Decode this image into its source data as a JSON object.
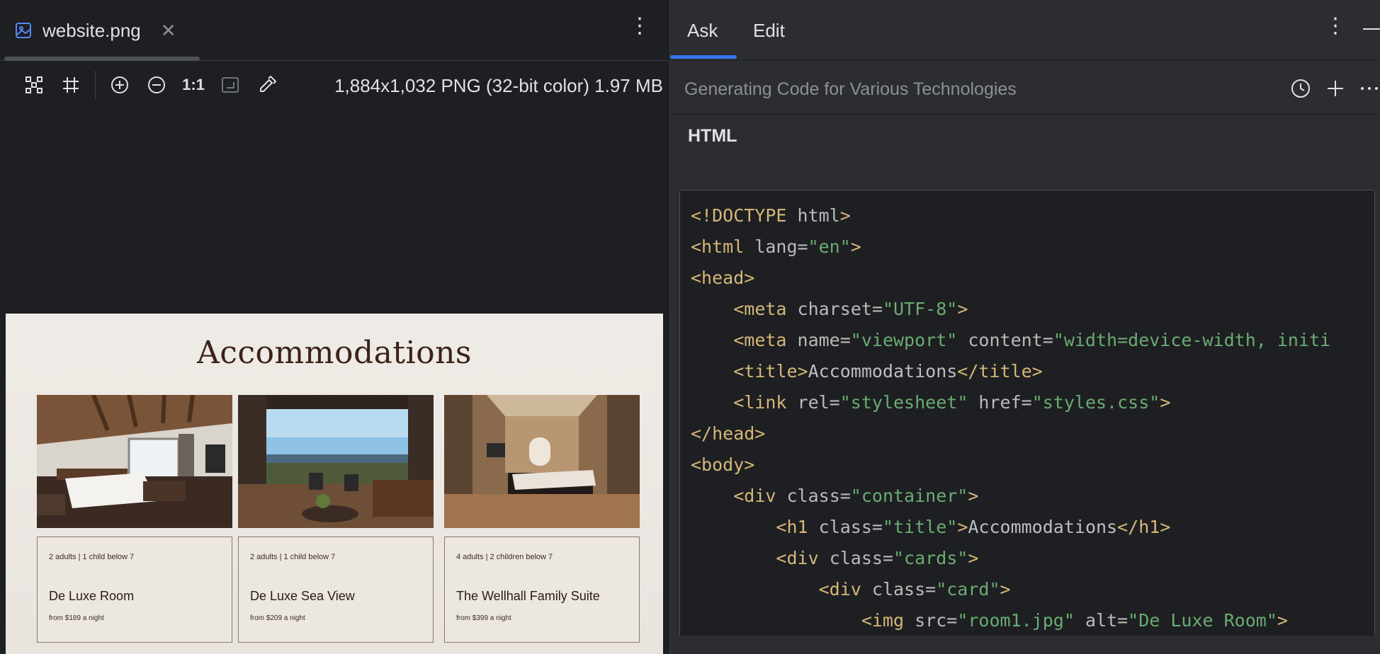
{
  "viewer": {
    "tab": {
      "label": "website.png",
      "icon": "image-file-icon",
      "close": "✕"
    },
    "menu_glyph": "⋮",
    "toolbar": {
      "tools": [
        "fit-to-window-icon",
        "grid-icon",
        "zoom-in-icon",
        "zoom-out-icon"
      ],
      "actual_size_label": "1:1",
      "extra_tools": [
        "background-toggle-icon",
        "color-picker-icon"
      ]
    },
    "image_info": "1,884x1,032 PNG (32-bit color) 1.97 MB",
    "preview": {
      "title": "Accommodations",
      "cards": [
        {
          "guests": "2 adults | 1 child below 7",
          "name": "De Luxe Room",
          "price": "from $189 a night"
        },
        {
          "guests": "2 adults | 1 child below 7",
          "name": "De Luxe Sea View",
          "price": "from $209 a night"
        },
        {
          "guests": "4 adults | 2 children below 7",
          "name": "The Wellhall Family Suite",
          "price": "from $399 a night"
        }
      ]
    }
  },
  "assistant": {
    "tabs": [
      {
        "label": "Ask",
        "active": true
      },
      {
        "label": "Edit",
        "active": false
      }
    ],
    "menu_glyph": "⋮",
    "chat_title": "Generating Code for Various Technologies",
    "chat_actions": [
      "history-icon",
      "new-chat-icon",
      "more-icon"
    ],
    "section_label": "HTML",
    "code_lines": [
      [
        [
          "t",
          "<!DOCTYPE"
        ],
        [
          "a",
          " html"
        ],
        [
          "t",
          ">"
        ]
      ],
      [
        [
          "t",
          "<html "
        ],
        [
          "a",
          "lang="
        ],
        [
          "v",
          "\"en\""
        ],
        [
          "t",
          ">"
        ]
      ],
      [
        [
          "t",
          "<head>"
        ]
      ],
      [
        [
          "x",
          "    "
        ],
        [
          "t",
          "<meta "
        ],
        [
          "a",
          "charset="
        ],
        [
          "v",
          "\"UTF-8\""
        ],
        [
          "t",
          ">"
        ]
      ],
      [
        [
          "x",
          "    "
        ],
        [
          "t",
          "<meta "
        ],
        [
          "a",
          "name="
        ],
        [
          "v",
          "\"viewport\""
        ],
        [
          "a",
          " content="
        ],
        [
          "v",
          "\"width=device-width, initi"
        ]
      ],
      [
        [
          "x",
          "    "
        ],
        [
          "t",
          "<title>"
        ],
        [
          "x",
          "Accommodations"
        ],
        [
          "t",
          "</title>"
        ]
      ],
      [
        [
          "x",
          "    "
        ],
        [
          "t",
          "<link "
        ],
        [
          "a",
          "rel="
        ],
        [
          "v",
          "\"stylesheet\""
        ],
        [
          "a",
          " href="
        ],
        [
          "v",
          "\"styles.css\""
        ],
        [
          "t",
          ">"
        ]
      ],
      [
        [
          "t",
          "</head>"
        ]
      ],
      [
        [
          "t",
          "<body>"
        ]
      ],
      [
        [
          "x",
          "    "
        ],
        [
          "t",
          "<div "
        ],
        [
          "a",
          "class="
        ],
        [
          "v",
          "\"container\""
        ],
        [
          "t",
          ">"
        ]
      ],
      [
        [
          "x",
          "        "
        ],
        [
          "t",
          "<h1 "
        ],
        [
          "a",
          "class="
        ],
        [
          "v",
          "\"title\""
        ],
        [
          "t",
          ">"
        ],
        [
          "x",
          "Accommodations"
        ],
        [
          "t",
          "</h1>"
        ]
      ],
      [
        [
          "x",
          "        "
        ],
        [
          "t",
          "<div "
        ],
        [
          "a",
          "class="
        ],
        [
          "v",
          "\"cards\""
        ],
        [
          "t",
          ">"
        ]
      ],
      [
        [
          "x",
          "            "
        ],
        [
          "t",
          "<div "
        ],
        [
          "a",
          "class="
        ],
        [
          "v",
          "\"card\""
        ],
        [
          "t",
          ">"
        ]
      ],
      [
        [
          "x",
          "                "
        ],
        [
          "t",
          "<img "
        ],
        [
          "a",
          "src="
        ],
        [
          "v",
          "\"room1.jpg\""
        ],
        [
          "a",
          " alt="
        ],
        [
          "v",
          "\"De Luxe Room\""
        ],
        [
          "t",
          ">"
        ]
      ]
    ],
    "colors": {
      "accent": "#3574f0",
      "tag": "#d5b778",
      "string": "#6aab73",
      "attr": "#bababa"
    }
  }
}
